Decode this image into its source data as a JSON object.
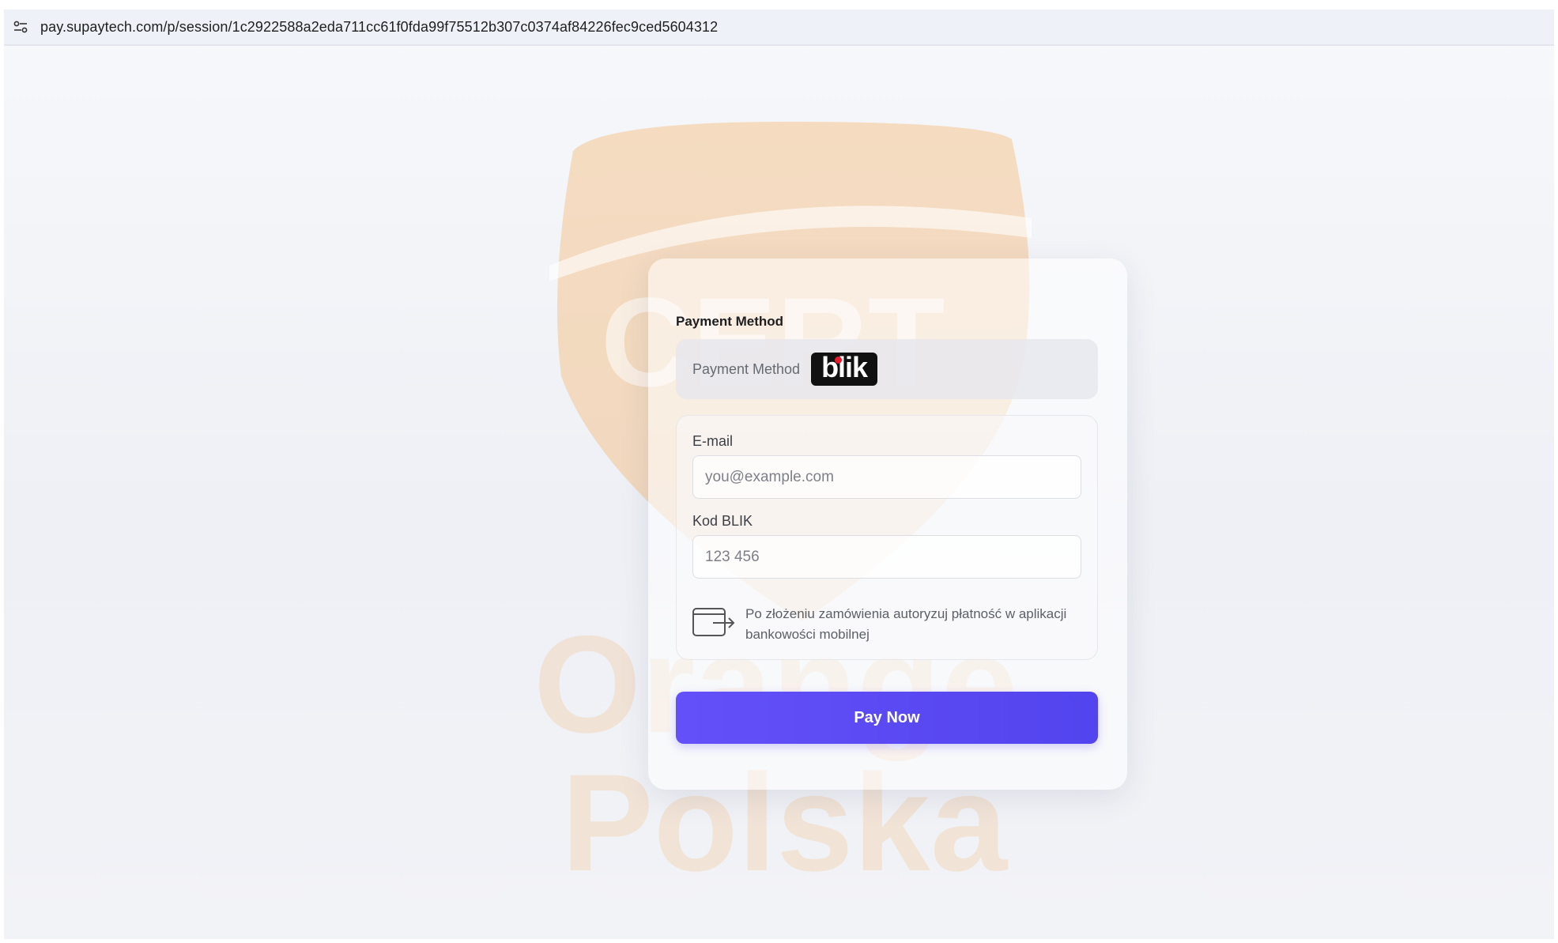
{
  "browser": {
    "url": "pay.supaytech.com/p/session/1c2922588a2eda711cc61f0fda99f75512b307c0374af84226fec9ced5604312",
    "site_info_icon": "tune-icon"
  },
  "watermark": {
    "line1": "CERT",
    "line2": "Orange",
    "line3": "Polska",
    "color": "#f6a44a"
  },
  "payment": {
    "section_label": "Payment Method",
    "method_label": "Payment Method",
    "method_logo_text": "blik",
    "email_label": "E-mail",
    "email_placeholder": "you@example.com",
    "email_value": "",
    "blik_label": "Kod BLIK",
    "blik_placeholder": "123 456",
    "blik_value": "",
    "hint_icon": "mobile-redirect-icon",
    "hint_text": "Po złożeniu zamówienia autoryzuj płatność w aplikacji bankowości mobilnej",
    "pay_button": "Pay Now",
    "accent_color": "#5b4af4"
  }
}
